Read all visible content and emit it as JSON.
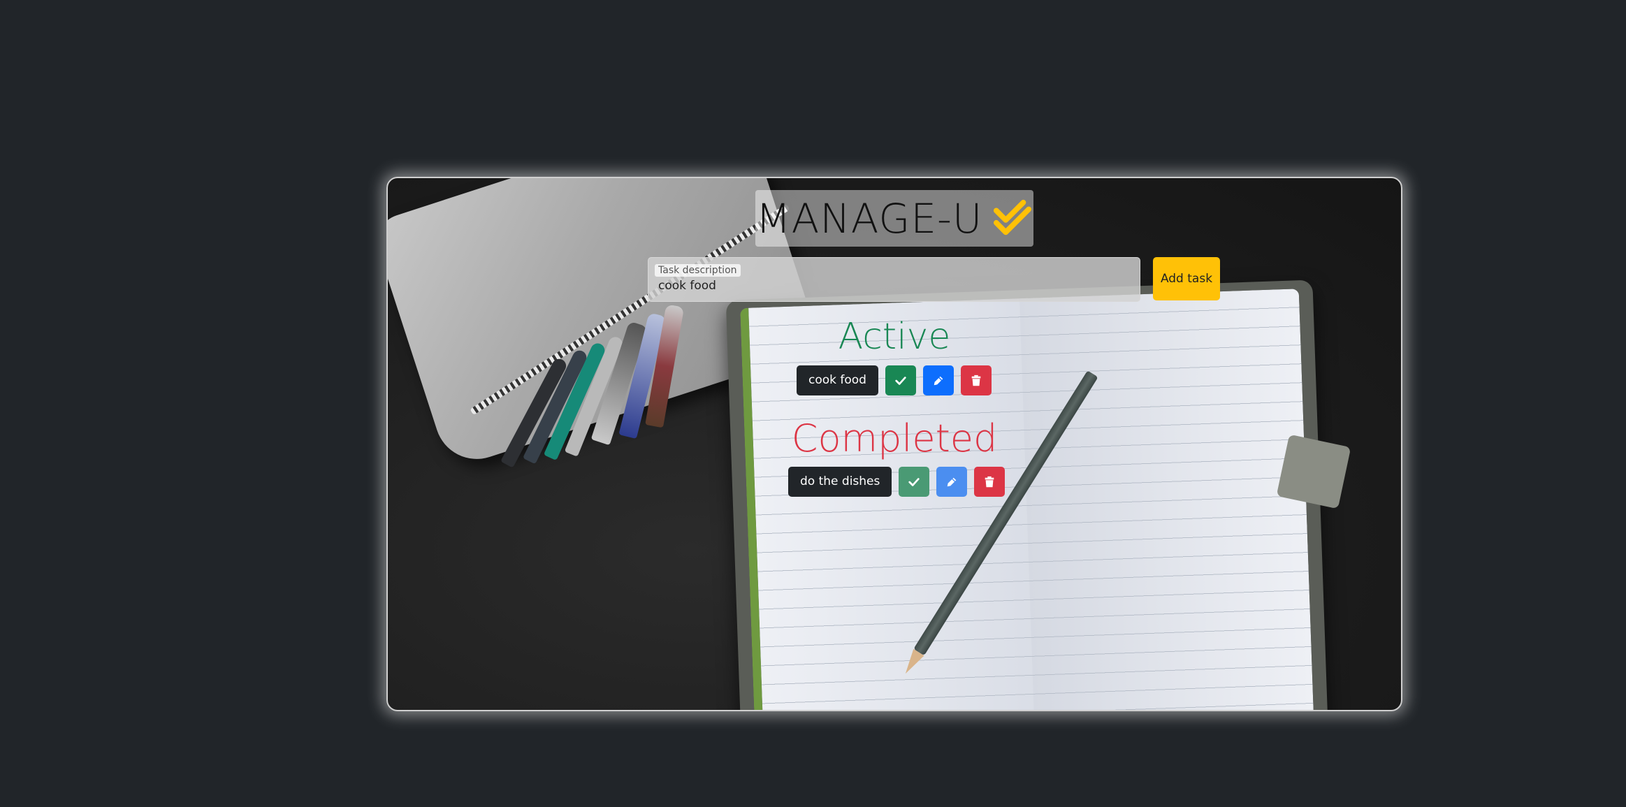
{
  "app": {
    "title": "MANAGE-U",
    "accent_color": "#ffc107"
  },
  "new_task": {
    "label": "Task description",
    "value": "cook food",
    "add_button_label": "Add task"
  },
  "active": {
    "heading": "Active",
    "color": "#198754",
    "tasks": [
      {
        "label": "cook food"
      }
    ]
  },
  "completed": {
    "heading": "Completed",
    "color": "#dc3545",
    "tasks": [
      {
        "label": "do the dishes"
      }
    ]
  },
  "icons": {
    "complete": "check-icon",
    "edit": "pencil-icon",
    "delete": "trash-icon",
    "logo": "double-check-icon"
  }
}
